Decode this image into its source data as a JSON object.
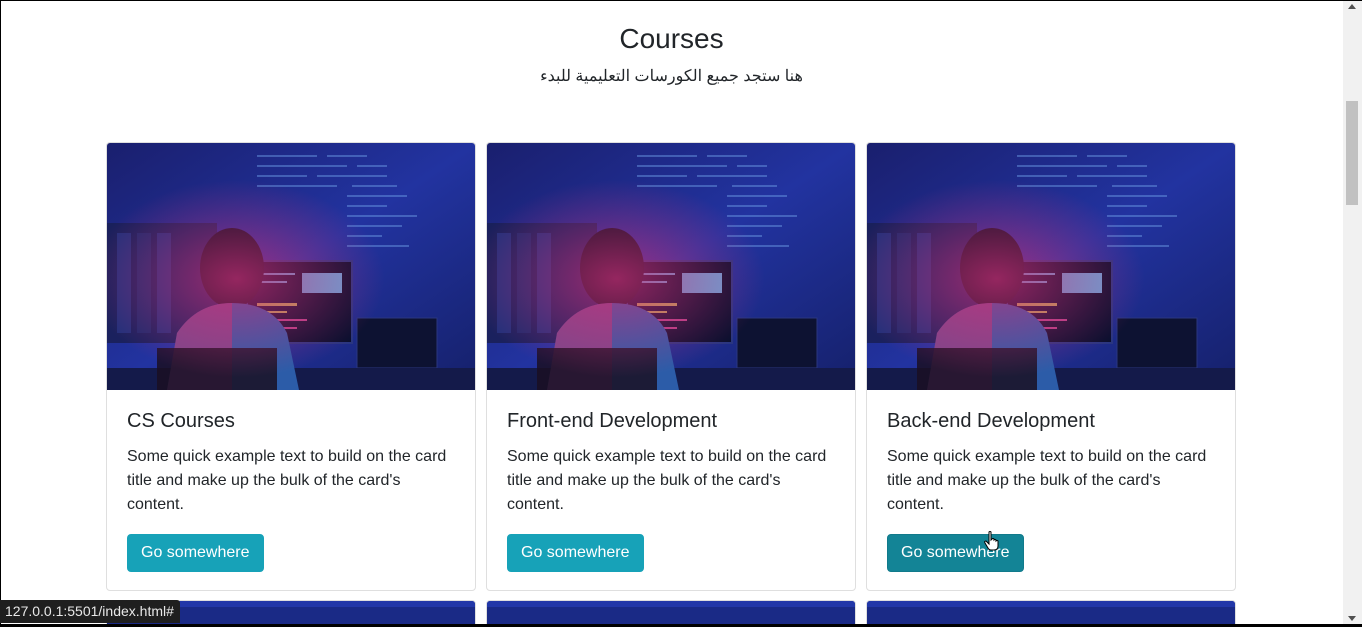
{
  "header": {
    "title": "Courses",
    "subtitle": "هنا ستجد جميع الكورسات التعليمية للبدء"
  },
  "cards": [
    {
      "title": "CS Courses",
      "text": "Some quick example text to build on the card title and make up the bulk of the card's content.",
      "button_label": "Go somewhere"
    },
    {
      "title": "Front-end Development",
      "text": "Some quick example text to build on the card title and make up the bulk of the card's content.",
      "button_label": "Go somewhere"
    },
    {
      "title": "Back-end Development",
      "text": "Some quick example text to build on the card title and make up the bulk of the card's content.",
      "button_label": "Go somewhere"
    }
  ],
  "status_bar": {
    "url": "127.0.0.1:5501/index.html#"
  },
  "colors": {
    "button": "#17a2b8",
    "button_hover": "#138496",
    "image_background": "#1d2a8a"
  },
  "icons": {
    "cursor": "hand-pointer-icon"
  }
}
